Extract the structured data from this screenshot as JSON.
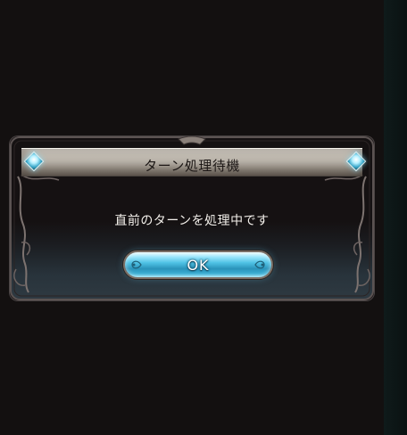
{
  "dialog": {
    "title": "ターン処理待機",
    "message": "直前のターンを処理中です",
    "ok_label": "OK"
  },
  "colors": {
    "background": "#131010",
    "title_bar": "#c9c3b8",
    "button_accent": "#4fc2e5",
    "gem": "#3aa7c9"
  },
  "icons": {
    "title_left": "diamond-gem-icon",
    "title_right": "diamond-gem-icon",
    "button_left": "scroll-ornament-icon",
    "button_right": "scroll-ornament-icon"
  }
}
